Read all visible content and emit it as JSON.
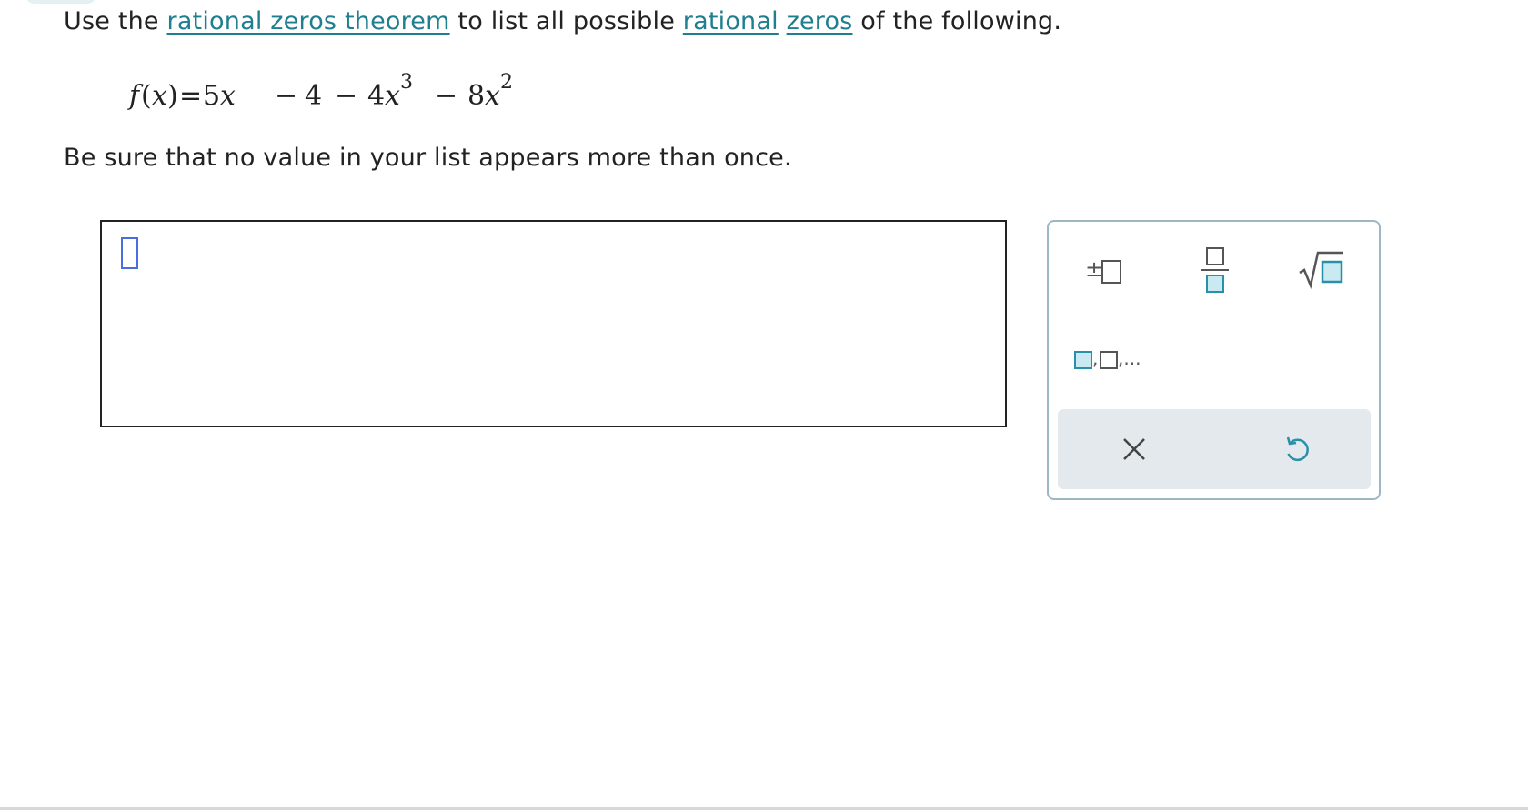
{
  "question": {
    "prefix": "Use the ",
    "link1": "rational zeros theorem",
    "middle": " to list all possible ",
    "link2": "rational",
    "link3": "zeros",
    "suffix": " of the following."
  },
  "equation": {
    "f": "f",
    "lparen": "(",
    "x": "x",
    "rparen": ")",
    "eq": "=",
    "t1_coef": "5",
    "t1_var": "x",
    "minus1": "−",
    "t2": "4",
    "minus2": "−",
    "t3_coef": "4",
    "t3_var": "x",
    "t3_exp": "3",
    "minus3": "−",
    "t4_coef": "8",
    "t4_var": "x",
    "t4_exp": "2"
  },
  "instruction": "Be sure that no value in your list appears more than once.",
  "answer": {
    "value": ""
  },
  "palette": {
    "plus_minus_symbol": "±",
    "list_separator": ",",
    "list_ellipsis": ",...",
    "clear_icon": "×",
    "buttons": [
      "plus-minus-icon",
      "fraction-icon",
      "square-root-icon",
      "list-icon",
      "clear-icon",
      "undo-icon"
    ]
  },
  "colors": {
    "link": "#1f7f8f",
    "accent": "#2a8fa8",
    "accent_fill": "#c9eaf1",
    "cursor": "#4a6ee0",
    "palette_border": "#9fb7c4",
    "palette_footer": "#e3e9ec"
  }
}
